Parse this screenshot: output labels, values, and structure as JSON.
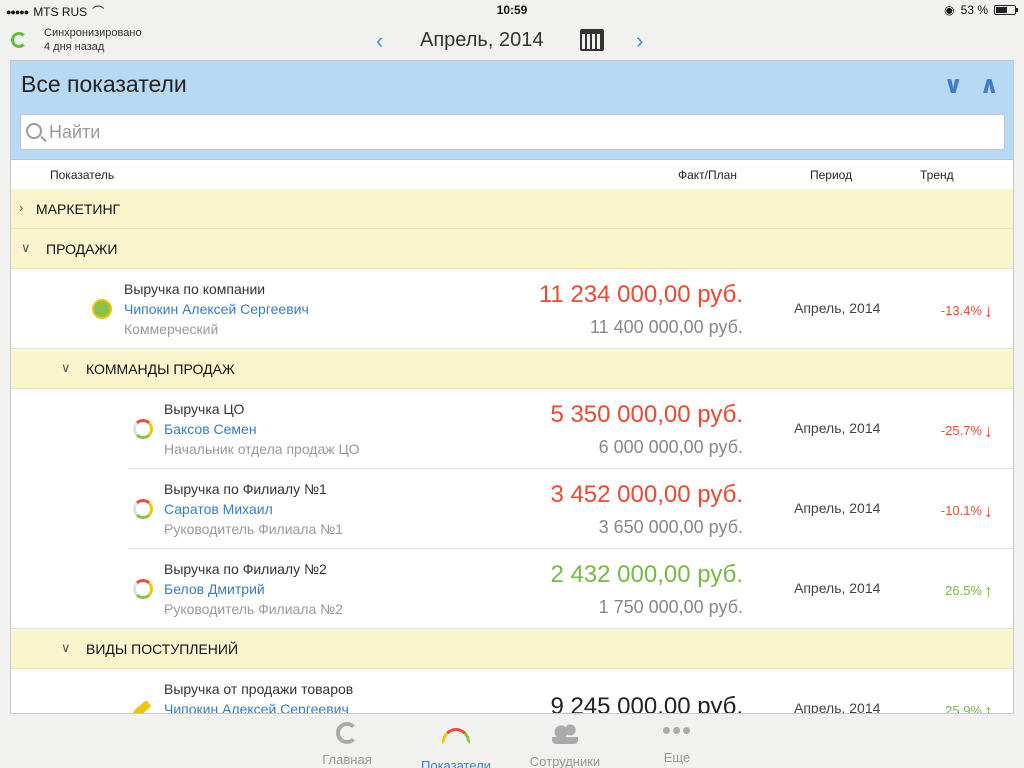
{
  "status_bar": {
    "carrier": "MTS RUS",
    "time": "10:59",
    "battery": "53 %",
    "battery_level": 0.53
  },
  "top_nav": {
    "sync_line1": "Синхронизировано",
    "sync_line2": "4 дня назад",
    "month": "Апрель, 2014",
    "prev_icon": "chevron-left-icon",
    "next_icon": "chevron-right-icon",
    "calendar_icon": "calendar-icon"
  },
  "panel": {
    "title": "Все показатели",
    "search_placeholder": "Найти",
    "columns": {
      "indicator": "Показатель",
      "fact_plan": "Факт/План",
      "period": "Период",
      "trend": "Тренд"
    }
  },
  "groups": {
    "marketing": "МАРКЕТИНГ",
    "sales": "ПРОДАЖИ",
    "sales_teams": "КОММАНДЫ ПРОДАЖ",
    "income_types": "ВИДЫ ПОСТУПЛЕНИЙ"
  },
  "rows": [
    {
      "name": "Выручка по компании",
      "owner": "Чипокин Алексей Сергеевич",
      "role": "Коммерческий",
      "fact": "11 234 000,00 руб.",
      "plan": "11 400 000,00 руб.",
      "period": "Апрель, 2014",
      "trend": "-13.4%",
      "trend_arrow": "↓",
      "status_color": "#e94a35",
      "icon": "person-kpi-icon"
    },
    {
      "name": "Выручка ЦО",
      "owner": "Баксов Семен",
      "role": "Начальник отдела продаж ЦО",
      "fact": "5 350 000,00 руб.",
      "plan": "6 000 000,00 руб.",
      "period": "Апрель, 2014",
      "trend": "-25.7%",
      "trend_arrow": "↓",
      "status_color": "#e94a35",
      "icon": "gauge-icon"
    },
    {
      "name": "Выручка по Филиалу №1",
      "owner": "Саратов Михаил",
      "role": "Руководитель Филиала №1",
      "fact": "3 452 000,00 руб.",
      "plan": "3 650 000,00 руб.",
      "period": "Апрель, 2014",
      "trend": "-10.1%",
      "trend_arrow": "↓",
      "status_color": "#e94a35",
      "icon": "gauge-icon"
    },
    {
      "name": "Выручка по Филиалу №2",
      "owner": "Белов Дмитрий",
      "role": "Руководитель Филиала №2",
      "fact": "2 432 000,00 руб.",
      "plan": "1 750 000,00 руб.",
      "period": "Апрель, 2014",
      "trend": "26.5%",
      "trend_arrow": "↑",
      "status_color": "#7ab648",
      "icon": "gauge-icon"
    },
    {
      "name": "Выручка от продажи товаров",
      "owner": "Чипокин Алексей Сергеевич",
      "role": "",
      "fact": "9 245 000,00 руб.",
      "plan": "",
      "period": "Апрель, 2014",
      "trend": "25.9%",
      "trend_arrow": "↑",
      "status_color": "#7ab648",
      "icon": "ruler-icon"
    }
  ],
  "tab_bar": [
    {
      "label": "Главная",
      "icon": "home-icon",
      "active": false
    },
    {
      "label": "Показатели",
      "icon": "gauge-icon",
      "active": true
    },
    {
      "label": "Сотрудники",
      "icon": "people-icon",
      "active": false
    },
    {
      "label": "Еще",
      "icon": "more-icon",
      "active": false
    }
  ]
}
